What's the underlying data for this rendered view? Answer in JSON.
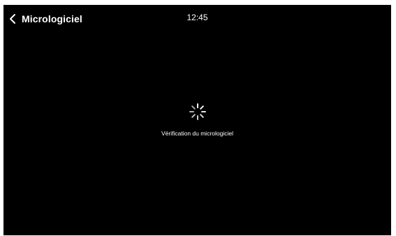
{
  "header": {
    "back_icon": "chevron-left-icon",
    "title": "Micrologiciel",
    "clock": "12:45"
  },
  "main": {
    "spinner_icon": "loading-spinner-icon",
    "status": "Vérification du micrologiciel"
  },
  "colors": {
    "background": "#000000",
    "text": "#ffffff",
    "outer": "#ffffff"
  }
}
